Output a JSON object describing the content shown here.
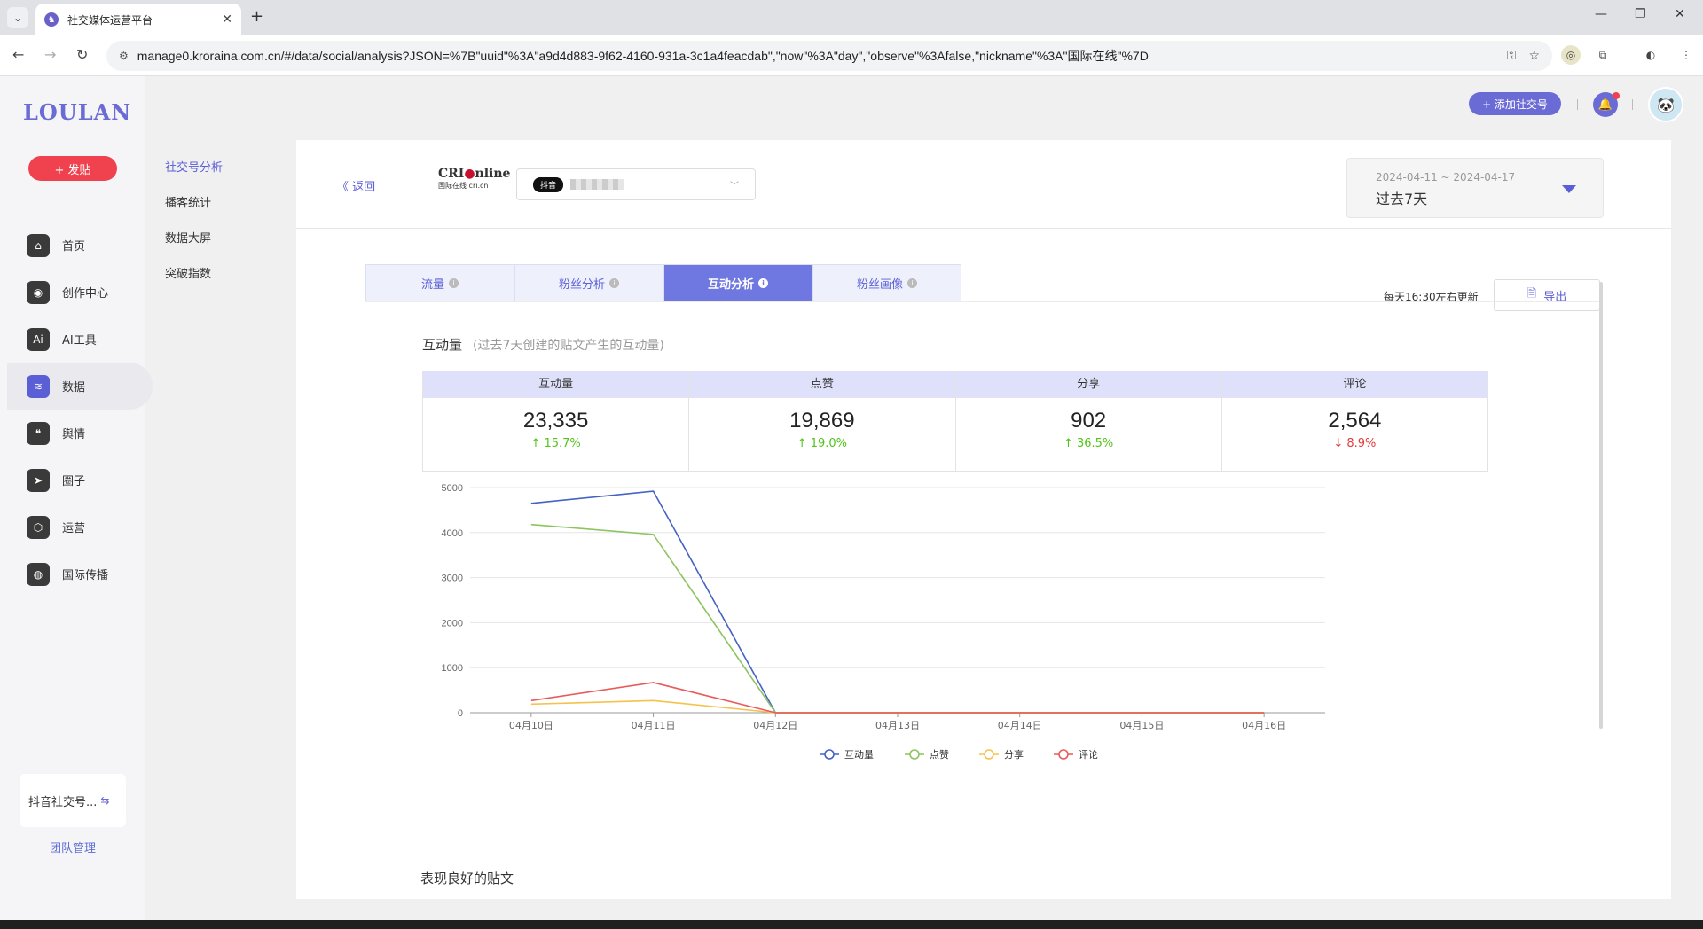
{
  "browser": {
    "tab_title": "社交媒体运营平台",
    "url": "manage0.kroraina.com.cn/#/data/social/analysis?JSON=%7B\"uuid\"%3A\"a9d4d883-9f62-4160-931a-3c1a4feacdab\",\"now\"%3A\"day\",\"observe\"%3Afalse,\"nickname\"%3A\"国际在线\"%7D"
  },
  "sidebar": {
    "logo": "LOULAN",
    "post_button": "+ 发贴",
    "items": [
      {
        "label": "首页",
        "icon": "home-icon"
      },
      {
        "label": "创作中心",
        "icon": "palette-icon"
      },
      {
        "label": "AI工具",
        "icon": "ai-icon"
      },
      {
        "label": "数据",
        "icon": "database-icon"
      },
      {
        "label": "舆情",
        "icon": "quote-icon"
      },
      {
        "label": "圈子",
        "icon": "compass-icon"
      },
      {
        "label": "运营",
        "icon": "shield-icon"
      },
      {
        "label": "国际传播",
        "icon": "globe-icon"
      }
    ],
    "active_index": 3,
    "account_card": "抖音社交号...",
    "team_link": "团队管理"
  },
  "subnav": [
    "社交号分析",
    "播客统计",
    "数据大屏",
    "突破指数"
  ],
  "header": {
    "add_social": "+ 添加社交号"
  },
  "main": {
    "back": "《 返回",
    "logo_line1": "CRI",
    "logo_line1b": "nline",
    "logo_line2": "国际在线 cri.cn",
    "platform_badge": "抖音",
    "date_range": "2024-04-11 ~ 2024-04-17",
    "date_label": "过去7天",
    "tabs": [
      "流量",
      "粉丝分析",
      "互动分析",
      "粉丝画像"
    ],
    "active_tab": 2,
    "update_note": "每天16:30左右更新",
    "export": "导出",
    "section_title": "互动量",
    "section_sub": "(过去7天创建的贴文产生的互动量)",
    "stats": [
      {
        "label": "互动量",
        "value": "23,335",
        "change": "↑ 15.7%",
        "dir": "up"
      },
      {
        "label": "点赞",
        "value": "19,869",
        "change": "↑ 19.0%",
        "dir": "up"
      },
      {
        "label": "分享",
        "value": "902",
        "change": "↑ 36.5%",
        "dir": "up"
      },
      {
        "label": "评论",
        "value": "2,564",
        "change": "↓ 8.9%",
        "dir": "down"
      }
    ],
    "bottom_title": "表现良好的贴文"
  },
  "chart_data": {
    "type": "line",
    "categories": [
      "04月10日",
      "04月11日",
      "04月12日",
      "04月13日",
      "04月14日",
      "04月15日",
      "04月16日"
    ],
    "ylim": [
      0,
      5000
    ],
    "yticks": [
      0,
      1000,
      2000,
      3000,
      4000,
      5000
    ],
    "series": [
      {
        "name": "互动量",
        "color": "#4561c4",
        "values": [
          4650,
          4920,
          0,
          0,
          0,
          0,
          0
        ]
      },
      {
        "name": "点赞",
        "color": "#8cc45f",
        "values": [
          4180,
          3960,
          0,
          0,
          0,
          0,
          0
        ]
      },
      {
        "name": "分享",
        "color": "#f5c24c",
        "values": [
          190,
          270,
          0,
          0,
          0,
          0,
          0
        ]
      },
      {
        "name": "评论",
        "color": "#ea5a5a",
        "values": [
          270,
          670,
          0,
          0,
          0,
          0,
          0
        ]
      }
    ],
    "grid": true,
    "legend": "bottom-center"
  }
}
